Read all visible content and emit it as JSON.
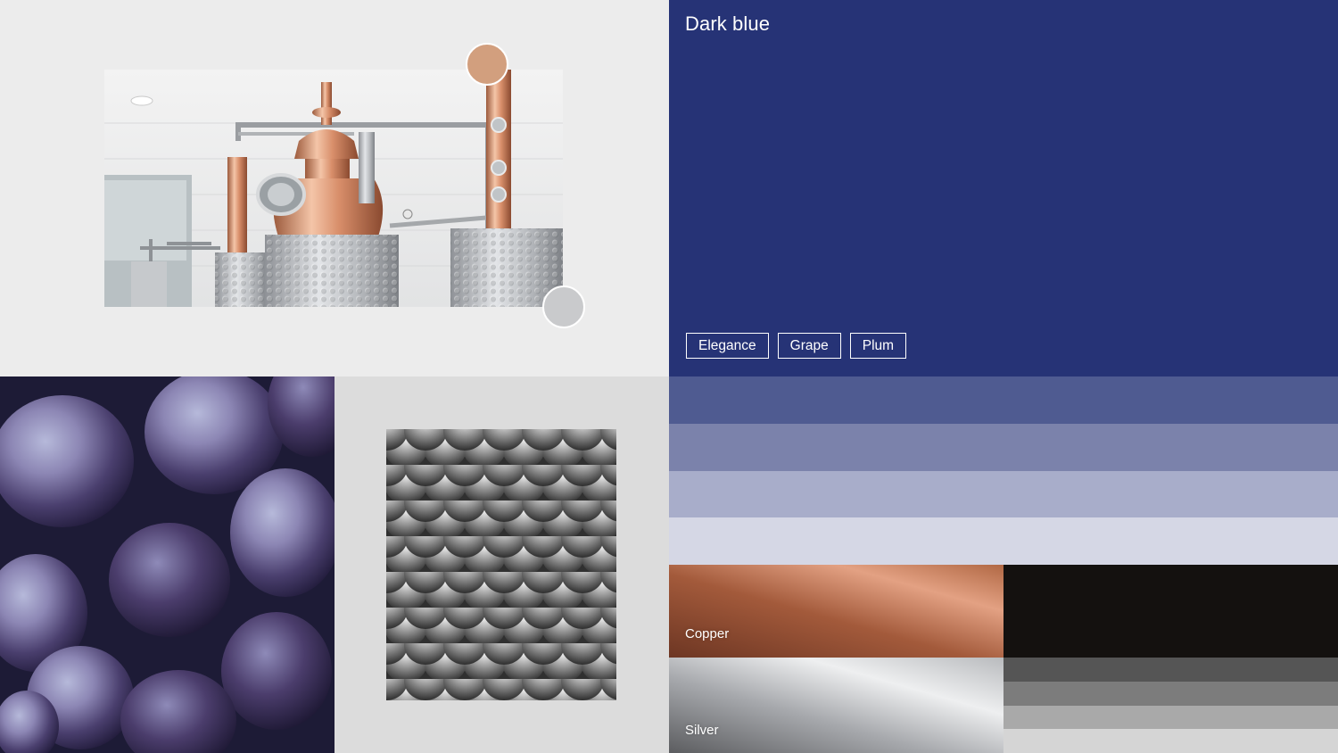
{
  "blue_panel": {
    "title": "Dark blue",
    "color": "#263376",
    "tags": [
      {
        "label": "Elegance"
      },
      {
        "label": "Grape"
      },
      {
        "label": "Plum"
      }
    ]
  },
  "accent_swatches": {
    "copper_dot": "#d29f7e",
    "silver_dot": "#c9cacc"
  },
  "tints": [
    "#4f5b91",
    "#7b82ab",
    "#a8adca",
    "#d5d7e5"
  ],
  "materials": {
    "copper_label": "Copper",
    "silver_label": "Silver"
  },
  "neutrals": {
    "black": "#14110f",
    "stripes": [
      "#555555",
      "#7c7c7c",
      "#a9a9a9",
      "#d5d5d5"
    ]
  }
}
